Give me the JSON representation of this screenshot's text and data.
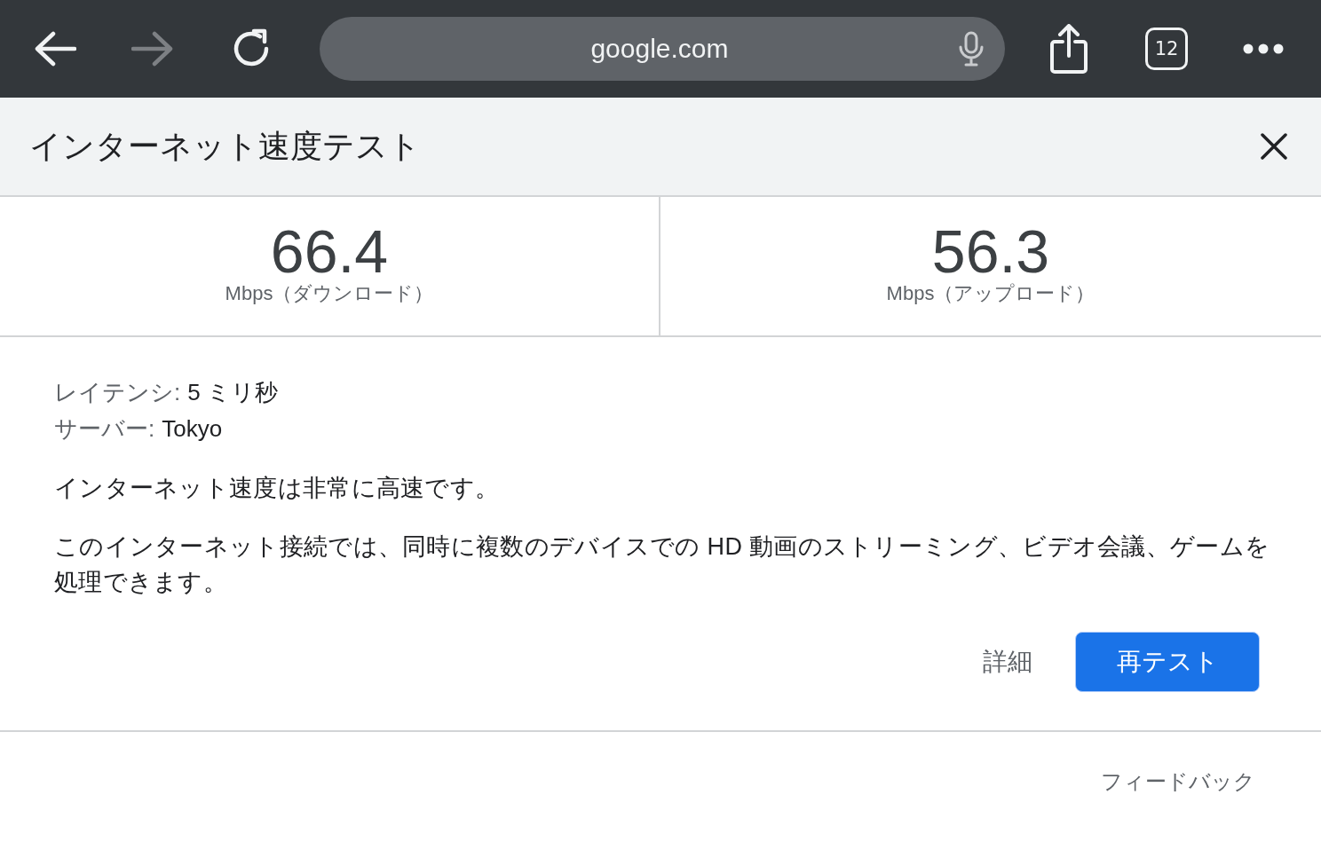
{
  "browser_toolbar": {
    "back": {
      "disabled": false
    },
    "forward": {
      "disabled": true
    },
    "address": "google.com",
    "tab_count": "12"
  },
  "panel": {
    "title": "インターネット速度テスト",
    "results": [
      {
        "value": "66.4",
        "unit": "Mbps（ダウンロード）"
      },
      {
        "value": "56.3",
        "unit": "Mbps（アップロード）"
      }
    ],
    "details": [
      {
        "label": "レイテンシ:",
        "value": "5 ミリ秒"
      },
      {
        "label": "サーバー:",
        "value": "Tokyo"
      }
    ],
    "summary": "インターネット速度は非常に高速です。",
    "description": "このインターネット接続では、同時に複数のデバイスでの HD 動画のストリーミング、ビデオ会議、ゲームを処理できます。",
    "buttons": [
      {
        "label": "詳細",
        "kind": "text"
      },
      {
        "label": "再テスト",
        "kind": "primary"
      }
    ],
    "feedback": "フィードバック"
  }
}
